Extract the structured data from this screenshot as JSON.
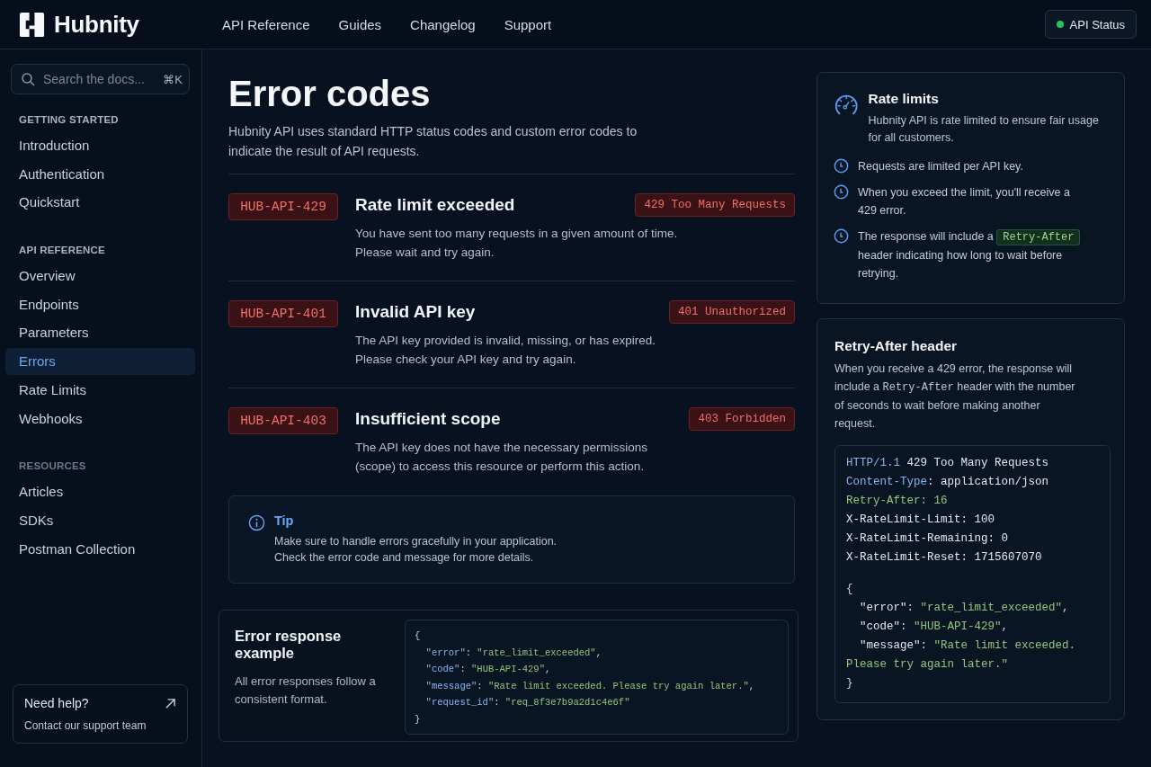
{
  "header": {
    "brand": "Hubnity",
    "nav": [
      {
        "label": "API Reference"
      },
      {
        "label": "Guides"
      },
      {
        "label": "Changelog"
      },
      {
        "label": "Support"
      }
    ],
    "status_button": {
      "label": "API Status",
      "online": true
    }
  },
  "sidebar": {
    "search": {
      "placeholder": "Search the docs...",
      "shortcut": "⌘K"
    },
    "sections": [
      {
        "title": "GETTING STARTED",
        "items": [
          {
            "label": "Introduction",
            "selected": false
          },
          {
            "label": "Authentication",
            "selected": false
          },
          {
            "label": "Quickstart",
            "selected": false
          }
        ]
      },
      {
        "title": "API REFERENCE",
        "items": [
          {
            "label": "Overview",
            "selected": false
          },
          {
            "label": "Endpoints",
            "selected": false
          },
          {
            "label": "Parameters",
            "selected": false
          },
          {
            "label": "Errors",
            "selected": true
          },
          {
            "label": "Rate Limits",
            "selected": false
          },
          {
            "label": "Webhooks",
            "selected": false
          }
        ]
      },
      {
        "title": "RESOURCES",
        "items": [
          {
            "label": "Articles",
            "selected": false
          },
          {
            "label": "SDKs",
            "selected": false
          },
          {
            "label": "Postman Collection",
            "selected": false
          }
        ]
      }
    ],
    "help": {
      "title": "Need help?",
      "text": "Contact our support team"
    }
  },
  "main": {
    "title": "Error codes",
    "intro": "Hubnity API uses standard HTTP status codes and custom error codes to indicate the result of API requests.",
    "errors": [
      {
        "code": "HUB-API-429",
        "title": "Rate limit exceeded",
        "status": "429 Too Many Requests",
        "description": "You have sent too many requests in a given amount of time.\nPlease wait and try again."
      },
      {
        "code": "HUB-API-401",
        "title": "Invalid API key",
        "status": "401 Unauthorized",
        "description": "The API key provided is invalid, missing, or has expired.\nPlease check your API key and try again."
      },
      {
        "code": "HUB-API-403",
        "title": "Insufficient scope",
        "status": "403 Forbidden",
        "description": "The API key does not have the necessary permissions\n(scope) to access this resource or perform this action."
      }
    ],
    "tip": {
      "title": "Tip",
      "text": "Make sure to handle errors gracefully in your application.\nCheck the error code and message for more details."
    },
    "example": {
      "title": "Error response example",
      "text": "All error responses follow a consistent format.",
      "code": [
        [
          {
            "t": "{",
            "kind": "punct"
          }
        ],
        [
          {
            "t": "  \"error\"",
            "kind": "key"
          },
          {
            "t": ": ",
            "kind": "punct"
          },
          {
            "t": "\"rate_limit_exceeded\"",
            "kind": "string"
          },
          {
            "t": ",",
            "kind": "punct"
          }
        ],
        [
          {
            "t": "  \"code\"",
            "kind": "key"
          },
          {
            "t": ": ",
            "kind": "punct"
          },
          {
            "t": "\"HUB-API-429\"",
            "kind": "string"
          },
          {
            "t": ",",
            "kind": "punct"
          }
        ],
        [
          {
            "t": "  \"message\"",
            "kind": "key"
          },
          {
            "t": ": ",
            "kind": "punct"
          },
          {
            "t": "\"Rate limit exceeded. Please try again later.\"",
            "kind": "string"
          },
          {
            "t": ",",
            "kind": "punct"
          }
        ],
        [
          {
            "t": "  \"request_id\"",
            "kind": "key"
          },
          {
            "t": ": ",
            "kind": "punct"
          },
          {
            "t": "\"req_8f3e7b9a2d1c4e6f\"",
            "kind": "string"
          }
        ],
        [
          {
            "t": "}",
            "kind": "punct"
          }
        ]
      ]
    }
  },
  "aside": {
    "rate_limits": {
      "title": "Rate limits",
      "text": "Hubnity API is rate limited to ensure fair usage for all customers.",
      "points": [
        [
          {
            "t": "Requests are limited per API key.",
            "kind": "text"
          }
        ],
        [
          {
            "t": "When you exceed the limit, you'll receive a 429 error.",
            "kind": "text"
          }
        ],
        [
          {
            "t": "The response will include a ",
            "kind": "text"
          },
          {
            "t": "Retry-After",
            "kind": "code"
          },
          {
            "t": " header indicating how long to wait before retrying.",
            "kind": "text"
          }
        ]
      ]
    },
    "retry_after": {
      "title": "Retry-After header",
      "text": [
        {
          "t": "When you receive a 429 error, the response will include a ",
          "kind": "text"
        },
        {
          "t": "Retry-After",
          "kind": "code"
        },
        {
          "t": " header with the number of seconds to wait before making another request.",
          "kind": "text"
        }
      ],
      "headers": [
        [
          {
            "t": "HTTP/1.1",
            "kind": "key"
          },
          {
            "t": " 429 Too Many Requests",
            "kind": "plain"
          }
        ],
        [
          {
            "t": "Content-Type",
            "kind": "key"
          },
          {
            "t": ": application/json",
            "kind": "plain"
          }
        ],
        [
          {
            "t": "Retry-After: 16",
            "kind": "string"
          }
        ],
        [
          {
            "t": "X-RateLimit-Limit: 100",
            "kind": "plain"
          }
        ],
        [
          {
            "t": "X-RateLimit-Remaining: 0",
            "kind": "plain"
          }
        ],
        [
          {
            "t": "X-RateLimit-Reset: 1715607070",
            "kind": "plain"
          }
        ]
      ],
      "body": [
        [
          {
            "t": "{",
            "kind": "punct"
          }
        ],
        [
          {
            "t": "  \"error\"",
            "kind": "plain"
          },
          {
            "t": ": ",
            "kind": "punct"
          },
          {
            "t": "\"rate_limit_exceeded\"",
            "kind": "string"
          },
          {
            "t": ",",
            "kind": "punct"
          }
        ],
        [
          {
            "t": "  \"code\"",
            "kind": "plain"
          },
          {
            "t": ": ",
            "kind": "punct"
          },
          {
            "t": "\"HUB-API-429\"",
            "kind": "string"
          },
          {
            "t": ",",
            "kind": "punct"
          }
        ],
        [
          {
            "t": "  \"message\"",
            "kind": "plain"
          },
          {
            "t": ": ",
            "kind": "punct"
          },
          {
            "t": "\"Rate limit exceeded. Please try again later.\"",
            "kind": "string"
          }
        ],
        [
          {
            "t": "}",
            "kind": "punct"
          }
        ]
      ]
    }
  }
}
